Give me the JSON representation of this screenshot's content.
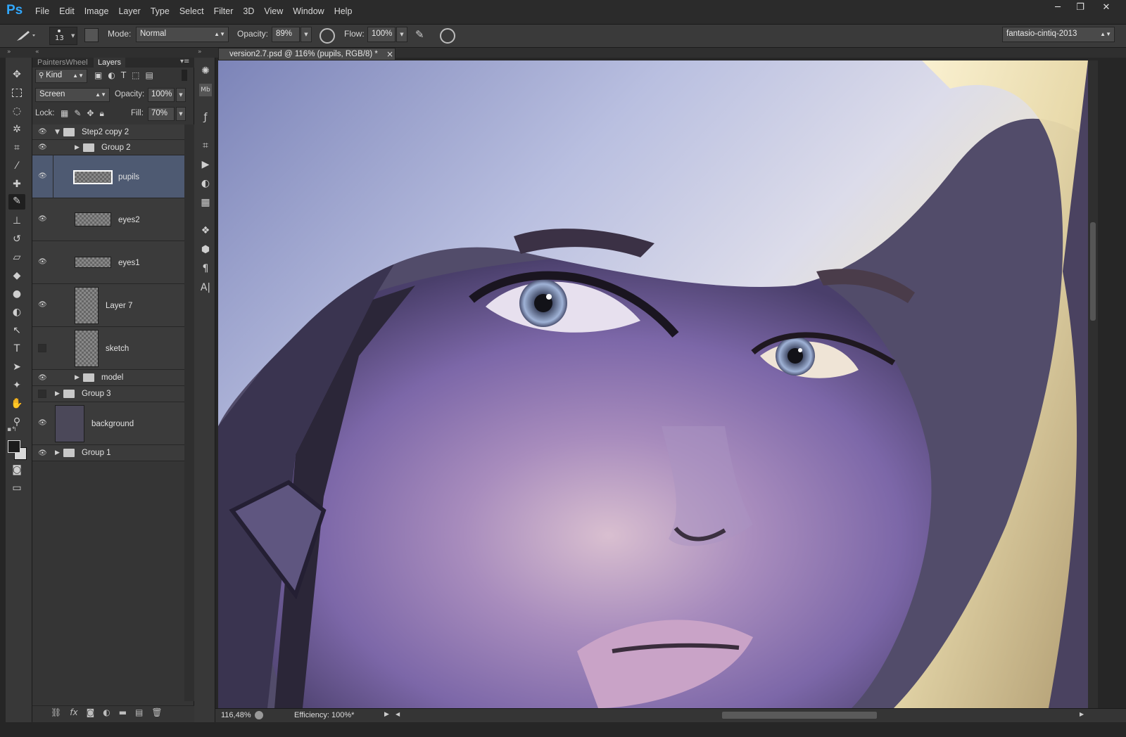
{
  "app": {
    "logo": "Ps"
  },
  "menu": [
    "File",
    "Edit",
    "Image",
    "Layer",
    "Type",
    "Select",
    "Filter",
    "3D",
    "View",
    "Window",
    "Help"
  ],
  "window_controls": {
    "minimize": "─",
    "restore": "❐",
    "close": "✕"
  },
  "options_bar": {
    "brush_size": "13",
    "mode_label": "Mode:",
    "mode_value": "Normal",
    "opacity_label": "Opacity:",
    "opacity_value": "89%",
    "flow_label": "Flow:",
    "flow_value": "100%",
    "workspace": "fantasio-cintiq-2013"
  },
  "panel_tabs": [
    "PaintersWheel",
    "Layers"
  ],
  "layers_panel": {
    "filter_kind": "Kind",
    "blend_mode": "Screen",
    "opacity_label": "Opacity:",
    "opacity_value": "100%",
    "lock_label": "Lock:",
    "fill_label": "Fill:",
    "fill_value": "70%",
    "layers": [
      {
        "name": "Step2 copy 2",
        "type": "group",
        "expanded": true,
        "visible": true
      },
      {
        "name": "Group 2",
        "type": "group",
        "expanded": false,
        "visible": true
      },
      {
        "name": "pupils",
        "type": "layer",
        "visible": true,
        "selected": true
      },
      {
        "name": "eyes2",
        "type": "layer",
        "visible": true
      },
      {
        "name": "eyes1",
        "type": "layer",
        "visible": true
      },
      {
        "name": "Layer 7",
        "type": "layer",
        "visible": true
      },
      {
        "name": "sketch",
        "type": "layer",
        "visible": false
      },
      {
        "name": "model",
        "type": "group",
        "expanded": false,
        "visible": true
      },
      {
        "name": "Group 3",
        "type": "group",
        "expanded": false,
        "visible": false
      },
      {
        "name": "background",
        "type": "layer",
        "visible": true
      },
      {
        "name": "Group 1",
        "type": "group",
        "expanded": false,
        "visible": true
      }
    ],
    "footer_icons": [
      "link-icon",
      "fx-icon",
      "mask-icon",
      "adjustment-icon",
      "new-group-icon",
      "new-layer-icon",
      "trash-icon"
    ]
  },
  "document": {
    "tab_title": "version2.7.psd @ 116% (pupils, RGB/8) *",
    "close_glyph": "×",
    "zoom": "116,48%",
    "status": "Efficiency: 100%*"
  },
  "colors": {
    "accent": "#31a8ff",
    "selected_layer": "#4e5a72",
    "canvas_bg": "#524c6a"
  }
}
